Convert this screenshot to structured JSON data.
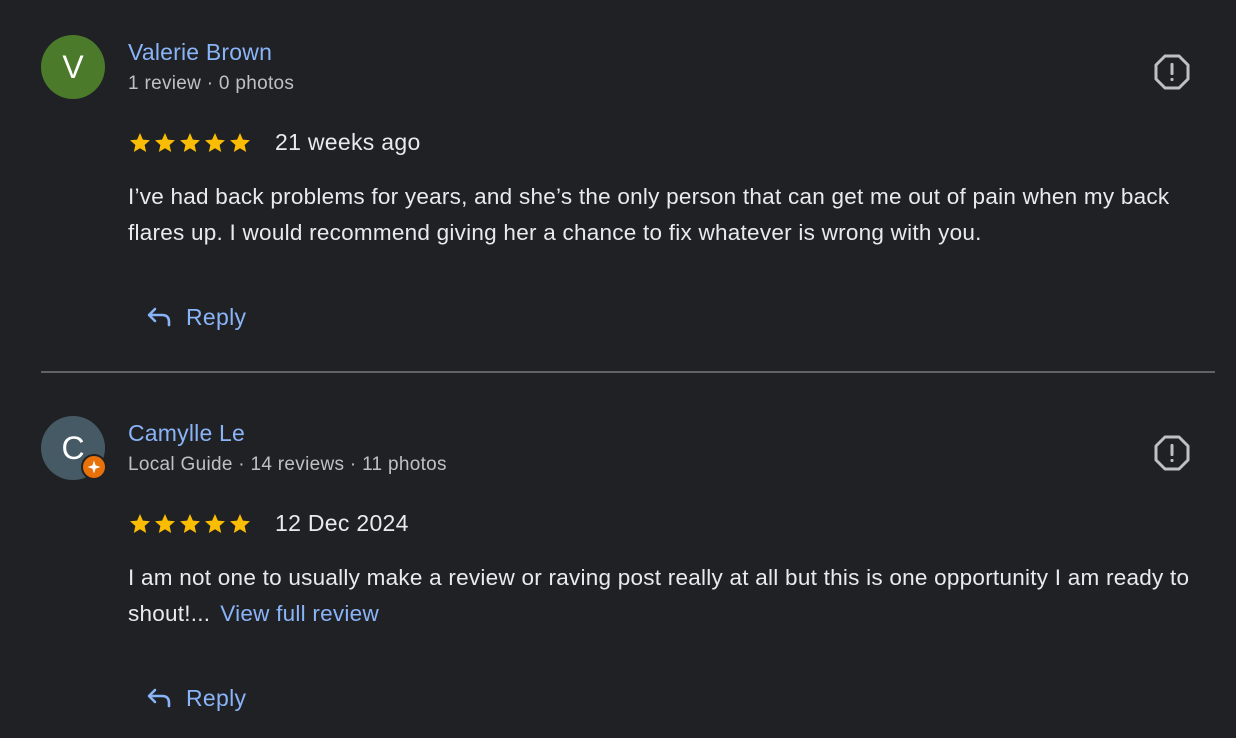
{
  "reviews": [
    {
      "initial": "V",
      "avatar_color": "#4b7a2a",
      "name": "Valerie Brown",
      "meta": "1 review · 0 photos",
      "local_guide": false,
      "rating": 5,
      "date": "21 weeks ago",
      "text": "I’ve had back problems for years, and she’s the only person that can get me out of pain when my back flares up. I would recommend giving her a chance to fix whatever is wrong with you.",
      "more_link": "",
      "reply_label": "Reply"
    },
    {
      "initial": "C",
      "avatar_color": "#455a64",
      "name": "Camylle Le",
      "meta": "Local Guide · 14 reviews · 11 photos",
      "local_guide": true,
      "rating": 5,
      "date": "12 Dec 2024",
      "text": "I am not one to usually make a review or raving post really at all but this is one opportunity I am ready to shout!...",
      "more_link": "View full review",
      "reply_label": "Reply"
    }
  ],
  "colors": {
    "background": "#202124",
    "link": "#8ab4f8",
    "star": "#fbbc04",
    "badge": "#e8710a"
  },
  "icons": {
    "report": "report-icon",
    "reply": "reply-arrow-icon",
    "star": "star-icon",
    "local_guide": "local-guide-badge-icon"
  }
}
